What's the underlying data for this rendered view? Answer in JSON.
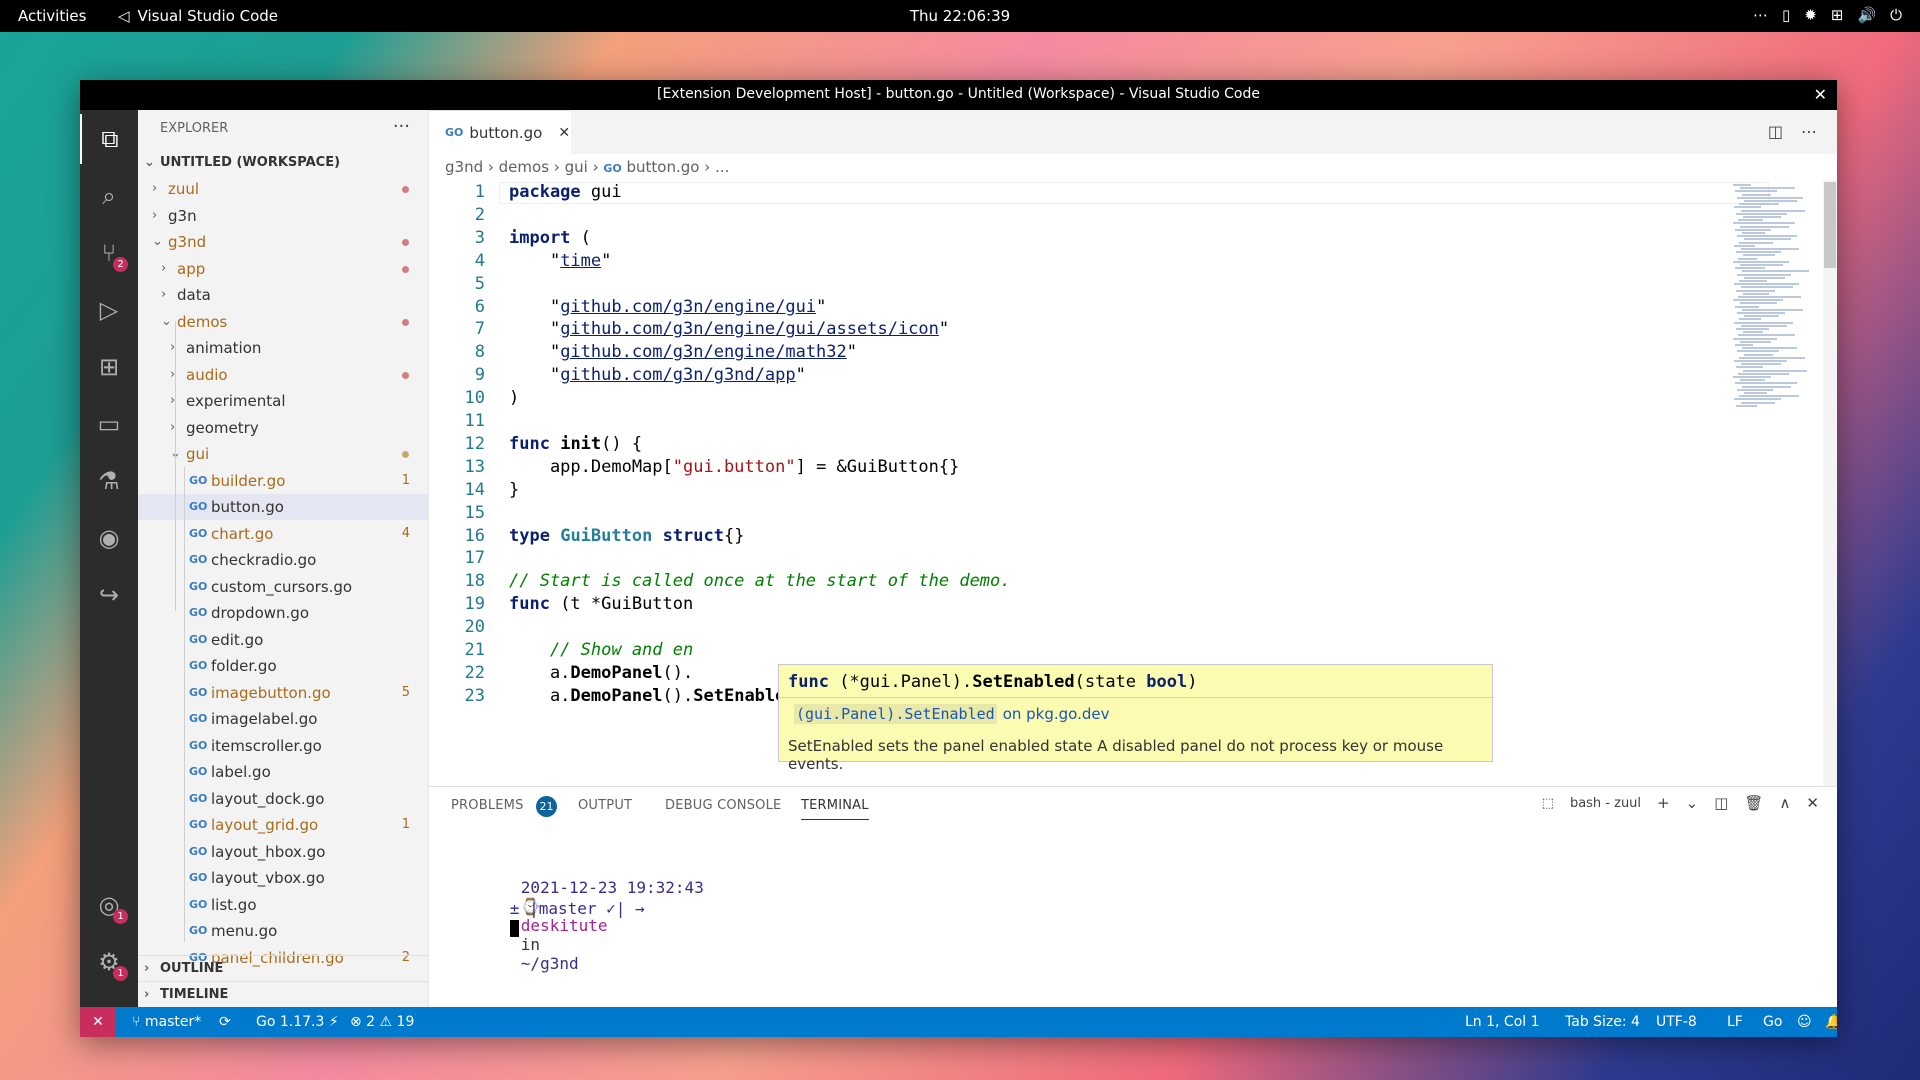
{
  "topbar": {
    "activities": "Activities",
    "app": "Visual Studio Code",
    "clock": "Thu 22:06:39",
    "tray": [
      "⋯",
      "▯",
      "✹",
      "⊞",
      "🔊",
      "⏻"
    ]
  },
  "window": {
    "title": "[Extension Development Host] - button.go - Untitled (Workspace) - Visual Studio Code",
    "close": "✕"
  },
  "activitybar": {
    "items": [
      {
        "name": "explorer-icon",
        "glyph": "⧉"
      },
      {
        "name": "search-icon",
        "glyph": "⌕"
      },
      {
        "name": "source-control-icon",
        "glyph": "⑂",
        "badge": "2"
      },
      {
        "name": "run-debug-icon",
        "glyph": "▷"
      },
      {
        "name": "extensions-icon",
        "glyph": "⊞"
      },
      {
        "name": "remote-explorer-icon",
        "glyph": "▭"
      },
      {
        "name": "testing-icon",
        "glyph": "⚗"
      },
      {
        "name": "github-icon",
        "glyph": "◉"
      },
      {
        "name": "live-share-icon",
        "glyph": "↪"
      }
    ],
    "accounts": {
      "glyph": "◎",
      "badge": "1"
    },
    "manage": {
      "glyph": "⚙",
      "badge": "1"
    }
  },
  "sidebar": {
    "title": "EXPLORER",
    "more": "···",
    "workspace": "UNTITLED (WORKSPACE)",
    "tree": [
      {
        "label": "zuul",
        "depth": 1,
        "chev": "›",
        "mod": true,
        "dot": true
      },
      {
        "label": "g3n",
        "depth": 1,
        "chev": "›"
      },
      {
        "label": "g3nd",
        "depth": 1,
        "chev": "⌄",
        "mod": true,
        "dot": true
      },
      {
        "label": "app",
        "depth": 2,
        "chev": "›",
        "mod": true,
        "dot": true
      },
      {
        "label": "data",
        "depth": 2,
        "chev": "›"
      },
      {
        "label": "demos",
        "depth": 2,
        "chev": "⌄",
        "mod": true,
        "dot": true
      },
      {
        "label": "animation",
        "depth": 3,
        "chev": "›"
      },
      {
        "label": "audio",
        "depth": 3,
        "chev": "›",
        "mod": true,
        "dot": true
      },
      {
        "label": "experimental",
        "depth": 3,
        "chev": "›"
      },
      {
        "label": "geometry",
        "depth": 3,
        "chev": "›"
      },
      {
        "label": "gui",
        "depth": 3,
        "chev": "⌄",
        "mod": true,
        "dot": true,
        "dotColor": "#c8a86a"
      },
      {
        "label": "builder.go",
        "depth": 4,
        "file": true,
        "mod": true,
        "num": "1"
      },
      {
        "label": "button.go",
        "depth": 4,
        "file": true,
        "selected": true
      },
      {
        "label": "chart.go",
        "depth": 4,
        "file": true,
        "mod": true,
        "num": "4"
      },
      {
        "label": "checkradio.go",
        "depth": 4,
        "file": true
      },
      {
        "label": "custom_cursors.go",
        "depth": 4,
        "file": true
      },
      {
        "label": "dropdown.go",
        "depth": 4,
        "file": true
      },
      {
        "label": "edit.go",
        "depth": 4,
        "file": true
      },
      {
        "label": "folder.go",
        "depth": 4,
        "file": true
      },
      {
        "label": "imagebutton.go",
        "depth": 4,
        "file": true,
        "mod": true,
        "num": "5"
      },
      {
        "label": "imagelabel.go",
        "depth": 4,
        "file": true
      },
      {
        "label": "itemscroller.go",
        "depth": 4,
        "file": true
      },
      {
        "label": "label.go",
        "depth": 4,
        "file": true
      },
      {
        "label": "layout_dock.go",
        "depth": 4,
        "file": true
      },
      {
        "label": "layout_grid.go",
        "depth": 4,
        "file": true,
        "mod": true,
        "num": "1"
      },
      {
        "label": "layout_hbox.go",
        "depth": 4,
        "file": true
      },
      {
        "label": "layout_vbox.go",
        "depth": 4,
        "file": true
      },
      {
        "label": "list.go",
        "depth": 4,
        "file": true
      },
      {
        "label": "menu.go",
        "depth": 4,
        "file": true
      },
      {
        "label": "panel_children.go",
        "depth": 4,
        "file": true,
        "mod": true,
        "num": "2"
      }
    ],
    "sections": [
      "OUTLINE",
      "TIMELINE"
    ],
    "go_icon": "GO"
  },
  "tabs": [
    {
      "label": "button.go",
      "close": "✕"
    }
  ],
  "breadcrumb": [
    "g3nd",
    "demos",
    "gui",
    "button.go",
    "..."
  ],
  "editor": {
    "lines": [
      [
        [
          "kw",
          "package"
        ],
        [
          "t",
          " gui"
        ]
      ],
      [],
      [
        [
          "kw",
          "import"
        ],
        [
          "t",
          " ("
        ]
      ],
      [
        [
          "t",
          "    \""
        ],
        [
          "lnk",
          "time"
        ],
        [
          "t",
          "\""
        ]
      ],
      [],
      [
        [
          "t",
          "    \""
        ],
        [
          "lnk",
          "github.com/g3n/engine/gui"
        ],
        [
          "t",
          "\""
        ]
      ],
      [
        [
          "t",
          "    \""
        ],
        [
          "lnk",
          "github.com/g3n/engine/gui/assets/icon"
        ],
        [
          "t",
          "\""
        ]
      ],
      [
        [
          "t",
          "    \""
        ],
        [
          "lnk",
          "github.com/g3n/engine/math32"
        ],
        [
          "t",
          "\""
        ]
      ],
      [
        [
          "t",
          "    \""
        ],
        [
          "lnk",
          "github.com/g3n/g3nd/app"
        ],
        [
          "t",
          "\""
        ]
      ],
      [
        [
          "t",
          ")"
        ]
      ],
      [],
      [
        [
          "kw",
          "func"
        ],
        [
          "t",
          " "
        ],
        [
          "fn",
          "init"
        ],
        [
          "t",
          "() {"
        ]
      ],
      [
        [
          "t",
          "    app.DemoMap["
        ],
        [
          "str",
          "\"gui.button\""
        ],
        [
          "t",
          "] = &GuiButton{}"
        ]
      ],
      [
        [
          "t",
          "}"
        ]
      ],
      [],
      [
        [
          "kw",
          "type"
        ],
        [
          "t",
          " "
        ],
        [
          "typ",
          "GuiButton"
        ],
        [
          "t",
          " "
        ],
        [
          "kw",
          "struct"
        ],
        [
          "t",
          "{}"
        ]
      ],
      [],
      [
        [
          "cmt",
          "// Start is called once at the start of the demo."
        ]
      ],
      [
        [
          "kw",
          "func"
        ],
        [
          "t",
          " (t *GuiButton"
        ]
      ],
      [],
      [
        [
          "cmt",
          "    // Show and en"
        ]
      ],
      [
        [
          "t",
          "    a."
        ],
        [
          "fn",
          "DemoPanel"
        ],
        [
          "t",
          "()."
        ]
      ],
      [
        [
          "t",
          "    a."
        ],
        [
          "fn",
          "DemoPanel"
        ],
        [
          "t",
          "()."
        ],
        [
          "fn",
          "SetEnabled"
        ],
        [
          "t",
          "("
        ],
        [
          "kw",
          "true"
        ],
        [
          "t",
          ")"
        ]
      ]
    ]
  },
  "hover": {
    "signature": [
      [
        "kw",
        "func"
      ],
      [
        "t",
        " (*gui.Panel)."
      ],
      [
        "fn",
        "SetEnabled"
      ],
      [
        "t",
        "(state "
      ],
      [
        "kw",
        "bool"
      ],
      [
        "t",
        ")"
      ]
    ],
    "link_code": "(gui.Panel).SetEnabled",
    "link_text": "on pkg.go.dev",
    "doc": "SetEnabled sets the panel enabled state A disabled panel do not process key or mouse events."
  },
  "panel": {
    "tabs": [
      "PROBLEMS",
      "OUTPUT",
      "DEBUG CONSOLE",
      "TERMINAL"
    ],
    "problems_count": "21",
    "terminal_name": "bash - zuul",
    "actions": [
      "+",
      "⌄",
      "◫",
      "🗑",
      "∧",
      "✕"
    ],
    "terminal": {
      "line1_time": "2021-12-23 19:32:43",
      "line1_watch": "⌚",
      "line1_user": "deskitute",
      "line1_in": "in",
      "line1_path": "~/g3nd",
      "line2": "± |master ✓| →"
    }
  },
  "statusbar": {
    "remote": "✕",
    "branch": "⑂ master*",
    "sync": "⟳",
    "go_version": "Go 1.17.3 ⚡",
    "errors": "⊗ 2 ⚠ 19",
    "position": "Ln 1, Col 1",
    "tab_size": "Tab Size: 4",
    "encoding": "UTF-8",
    "eol": "LF",
    "language": "Go",
    "feedback": "☺",
    "bell": "🔔"
  },
  "colors": {
    "accent": "#007acc",
    "remote": "#c72e5e",
    "modified": "#a86b1b"
  }
}
